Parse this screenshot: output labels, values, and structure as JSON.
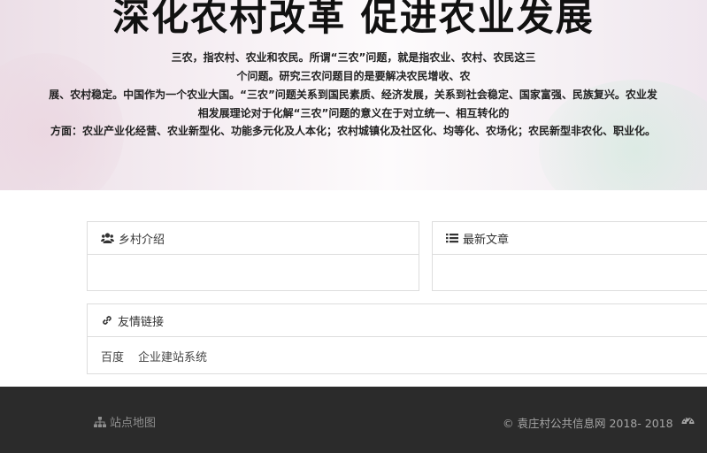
{
  "banner": {
    "title": "深化农村改革 促进农业发展",
    "lines": [
      "三农，指农村、农业和农民。所谓“三农”问题，就是指农业、农村、农民这三",
      "个问题。研究三农问题目的是要解决农民增收、农",
      "展、农村稳定。中国作为一个农业大国。“三农”问题关系到国民素质、经济发展，关系到社会稳定、国家富强、民族复兴。农业发",
      "相发展理论对于化解“三农”问题的意义在于对立统一、相互转化的",
      "方面：农业产业化经营、农业新型化、功能多元化及人本化；农村城镇化及社区化、均等化、农场化；农民新型非农化、职业化。"
    ]
  },
  "panels": {
    "intro": {
      "title": "乡村介绍",
      "icon": "users-icon"
    },
    "latest": {
      "title": "最新文章",
      "icon": "list-icon"
    },
    "friend_links": {
      "title": "友情链接",
      "icon": "link-icon",
      "items": [
        "百度",
        "企业建站系统"
      ]
    }
  },
  "footer": {
    "sitemap_label": "站点地图",
    "sitemap_icon": "sitemap-icon",
    "copyright": "© 袁庄村公共信息网 2018- 2018",
    "dashboard_icon": "dashboard-icon"
  },
  "colors": {
    "footer_bg": "#2b2b2b",
    "panel_border": "#dddddd"
  }
}
